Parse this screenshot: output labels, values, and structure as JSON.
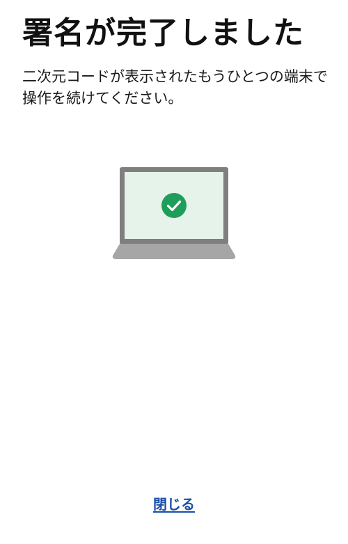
{
  "header": {
    "title": "署名が完了しました"
  },
  "body": {
    "message": "二次元コードが表示されたもうひとつの端末で操作を続けてください。"
  },
  "illustration": {
    "icon": "laptop-with-checkmark",
    "colors": {
      "frame": "#7f7f7f",
      "base": "#a6a6a6",
      "screen": "#e5f3ea",
      "check": "#1e9e5a"
    }
  },
  "footer": {
    "close_label": "閉じる",
    "link_color": "#1a4fa8"
  }
}
